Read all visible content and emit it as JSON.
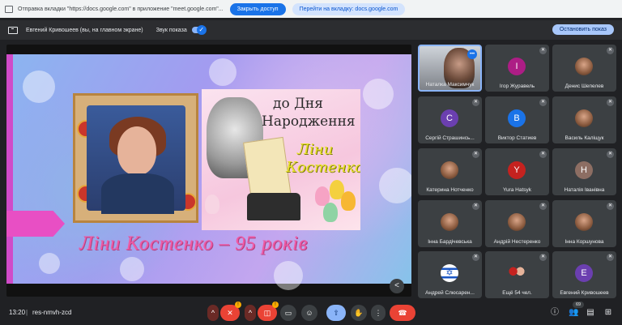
{
  "share_bar": {
    "message": "Отправка вкладки \"https://docs.google.com\" в приложение \"meet.google.com\"...",
    "close_access": "Закрыть доступ",
    "go_to_tab": "Перейти на вкладку: docs.google.com"
  },
  "presenter_bar": {
    "presenter_name": "Евгений Кривошеев (вы, на главном экране)",
    "sound_label": "Звук показа",
    "sound_toggle_check": "✓",
    "stop_label": "Остановить показ"
  },
  "slide": {
    "poster_line1": "до Дня",
    "poster_line2": "Народження",
    "poster_line3": "Ліни",
    "poster_line4": "Костенко",
    "caption": "Ліни Костенко – 95 років"
  },
  "participants": [
    {
      "name": "Наталка Максимчук",
      "initial": "",
      "color": "",
      "video": true,
      "speaking": true
    },
    {
      "name": "Ігор Журавель",
      "initial": "I",
      "color": "#ad1d85"
    },
    {
      "name": "Денис Шепелев",
      "initial": "",
      "color": "",
      "photo": true
    },
    {
      "name": "Сергій Страшинсь...",
      "initial": "C",
      "color": "#6b3fb0"
    },
    {
      "name": "Виктор Статиев",
      "initial": "B",
      "color": "#1a73e8"
    },
    {
      "name": "Василь Каліщук",
      "initial": "",
      "color": "",
      "photo": true
    },
    {
      "name": "Катерина Нотченко",
      "initial": "",
      "color": "",
      "photo": true
    },
    {
      "name": "Yura Hatsyk",
      "initial": "Y",
      "color": "#c5221f"
    },
    {
      "name": "Наталія Іванівна",
      "initial": "H",
      "color": "#8d6e63"
    },
    {
      "name": "Інна Бардічевська",
      "initial": "",
      "color": "",
      "photo": true
    },
    {
      "name": "Андрій Нестеренко",
      "initial": "",
      "color": "",
      "photo": true
    },
    {
      "name": "Інна Коршунова",
      "initial": "",
      "color": "",
      "photo": true
    },
    {
      "name": "Андрей Слюсарен...",
      "initial": "",
      "color": "",
      "flag": true
    },
    {
      "name": "Ещё 54 чел.",
      "initial": "",
      "color": "",
      "group": true
    },
    {
      "name": "Евгений Кривошеев",
      "initial": "E",
      "color": "#6b3fb0"
    }
  ],
  "toolbar": {
    "time": "13:20",
    "separator": "|",
    "meeting_code": "res-nmvh-zcd",
    "participant_count": "69",
    "icons": {
      "mic": "mic-off-icon",
      "camera": "camera-off-icon",
      "captions": "captions-icon",
      "emoji": "emoji-icon",
      "present": "present-icon",
      "hand": "raise-hand-icon",
      "more": "more-vert-icon",
      "leave": "call-end-icon",
      "info": "info-icon",
      "people": "people-icon",
      "chat": "chat-icon",
      "activities": "activities-icon"
    }
  },
  "colors": {
    "accent": "#1a73e8",
    "leave_red": "#ea4335",
    "background": "#202124"
  }
}
